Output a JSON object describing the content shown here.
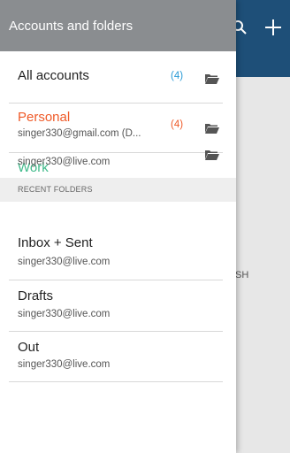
{
  "drawer": {
    "title": "Accounts and folders",
    "accounts": [
      {
        "name": "All accounts",
        "count": "(4)",
        "name_color": "#222222",
        "count_color": "#2a9bd6"
      },
      {
        "name": "Personal",
        "email": "singer330@gmail.com (D...",
        "count": "(4)",
        "name_color": "#ef5a28",
        "count_color": "#ef5a28"
      },
      {
        "name": "Work",
        "email": "singer330@live.com",
        "name_color": "#3fba8a"
      }
    ],
    "section_label": "RECENT FOLDERS",
    "recent_folders": [
      {
        "name": "Inbox + Sent",
        "email": "singer330@live.com"
      },
      {
        "name": "Drafts",
        "email": "singer330@live.com"
      },
      {
        "name": "Out",
        "email": "singer330@live.com"
      }
    ]
  },
  "background_app": {
    "partial_text": "SH",
    "header_color": "#1e4f78",
    "icons": [
      "search-icon",
      "add-icon"
    ]
  },
  "colors": {
    "drawer_header": "#8a8d90",
    "all_accounts_count": "#2a9bd6",
    "personal": "#ef5a28",
    "work": "#3fba8a"
  }
}
